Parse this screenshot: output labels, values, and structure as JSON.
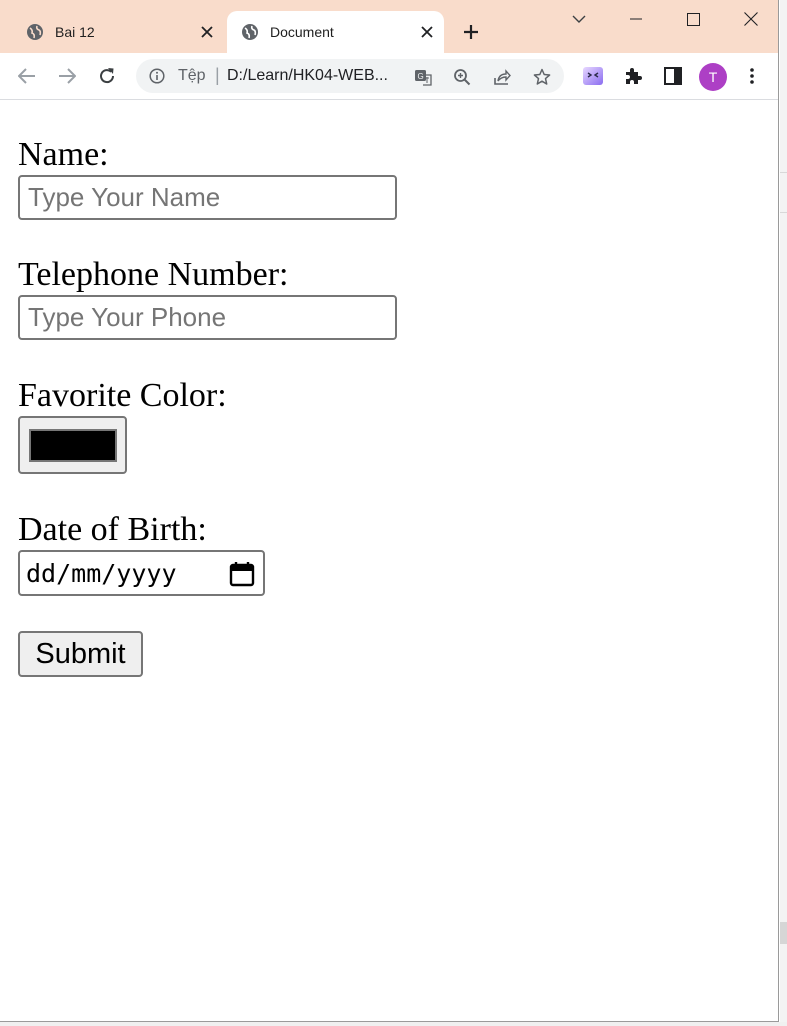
{
  "browser": {
    "tabs": [
      {
        "title": "Bai 12",
        "active": false,
        "favicon": "globe-icon"
      },
      {
        "title": "Document",
        "active": true,
        "favicon": "globe-icon"
      }
    ],
    "omnibox": {
      "scheme_label": "Tệp",
      "separator": "|",
      "url": "D:/Learn/HK04-WEB...",
      "icons": [
        "info-icon",
        "translate-icon",
        "zoom-icon",
        "share-icon",
        "star-icon"
      ]
    },
    "toolbar_icons": [
      "back-icon",
      "forward-icon",
      "reload-icon",
      "extension-icon",
      "puzzle-icon",
      "side-panel-icon",
      "menu-icon"
    ],
    "profile_initial": "T",
    "profile_color": "#ad3fc5",
    "tabstrip_color": "#f9dccb"
  },
  "form": {
    "name": {
      "label": "Name:",
      "placeholder": "Type Your Name",
      "value": ""
    },
    "phone": {
      "label": "Telephone Number:",
      "placeholder": "Type Your Phone",
      "value": ""
    },
    "color": {
      "label": "Favorite Color:",
      "value": "#000000"
    },
    "dob": {
      "label": "Date of Birth:",
      "display": "dd/mm/yyyy"
    },
    "submit_label": "Submit"
  }
}
